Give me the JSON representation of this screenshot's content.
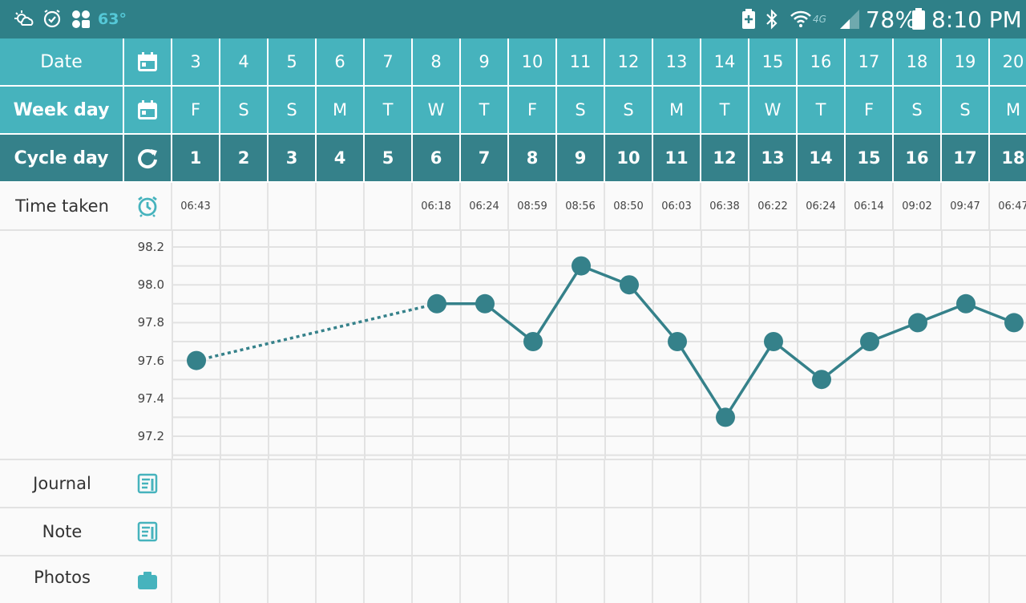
{
  "status_bar": {
    "temperature": "63°",
    "network": "4G",
    "battery": "78%",
    "time": "8:10 PM",
    "left_icons": [
      "weather-icon",
      "alarm-icon",
      "app-grid-icon"
    ],
    "right_icons": [
      "battery-saver-icon",
      "bluetooth-icon",
      "wifi-icon",
      "signal-icon",
      "battery-icon"
    ]
  },
  "rows": {
    "date": {
      "label": "Date",
      "icon": "calendar-icon"
    },
    "weekday": {
      "label": "Week day",
      "icon": "calendar-icon"
    },
    "cycle": {
      "label": "Cycle day",
      "icon": "refresh-icon"
    },
    "time": {
      "label": "Time taken",
      "icon": "alarm-clock-icon"
    },
    "journal": {
      "label": "Journal",
      "icon": "journal-icon"
    },
    "note": {
      "label": "Note",
      "icon": "note-icon"
    },
    "photos": {
      "label": "Photos",
      "icon": "camera-icon"
    }
  },
  "days": [
    {
      "date": "3",
      "weekday": "F",
      "cycle": "1",
      "time": "06:43",
      "temp": 97.6
    },
    {
      "date": "4",
      "weekday": "S",
      "cycle": "2",
      "time": "",
      "temp": null
    },
    {
      "date": "5",
      "weekday": "S",
      "cycle": "3",
      "time": "",
      "temp": null
    },
    {
      "date": "6",
      "weekday": "M",
      "cycle": "4",
      "time": "",
      "temp": null
    },
    {
      "date": "7",
      "weekday": "T",
      "cycle": "5",
      "time": "",
      "temp": null
    },
    {
      "date": "8",
      "weekday": "W",
      "cycle": "6",
      "time": "06:18",
      "temp": 97.9
    },
    {
      "date": "9",
      "weekday": "T",
      "cycle": "7",
      "time": "06:24",
      "temp": 97.9
    },
    {
      "date": "10",
      "weekday": "F",
      "cycle": "8",
      "time": "08:59",
      "temp": 97.7
    },
    {
      "date": "11",
      "weekday": "S",
      "cycle": "9",
      "time": "08:56",
      "temp": 98.1
    },
    {
      "date": "12",
      "weekday": "S",
      "cycle": "10",
      "time": "08:50",
      "temp": 98.0
    },
    {
      "date": "13",
      "weekday": "M",
      "cycle": "11",
      "time": "06:03",
      "temp": 97.7
    },
    {
      "date": "14",
      "weekday": "T",
      "cycle": "12",
      "time": "06:38",
      "temp": 97.3
    },
    {
      "date": "15",
      "weekday": "W",
      "cycle": "13",
      "time": "06:22",
      "temp": 97.7
    },
    {
      "date": "16",
      "weekday": "T",
      "cycle": "14",
      "time": "06:24",
      "temp": 97.5
    },
    {
      "date": "17",
      "weekday": "F",
      "cycle": "15",
      "time": "06:14",
      "temp": 97.7
    },
    {
      "date": "18",
      "weekday": "S",
      "cycle": "16",
      "time": "09:02",
      "temp": 97.8
    },
    {
      "date": "19",
      "weekday": "S",
      "cycle": "17",
      "time": "09:47",
      "temp": 97.9
    },
    {
      "date": "20",
      "weekday": "M",
      "cycle": "18",
      "time": "06:47",
      "temp": 97.8
    }
  ],
  "chart_data": {
    "type": "line",
    "x": [
      "1",
      "2",
      "3",
      "4",
      "5",
      "6",
      "7",
      "8",
      "9",
      "10",
      "11",
      "12",
      "13",
      "14",
      "15",
      "16",
      "17",
      "18"
    ],
    "series": [
      {
        "values": [
          97.6,
          null,
          null,
          null,
          null,
          97.9,
          97.9,
          97.7,
          98.1,
          98.0,
          97.7,
          97.3,
          97.7,
          97.5,
          97.7,
          97.8,
          97.9,
          97.8
        ]
      }
    ],
    "y_ticks": [
      "98.2",
      "98.0",
      "97.8",
      "97.6",
      "97.4",
      "97.2"
    ],
    "ylim": [
      97.1,
      98.2
    ],
    "gap_style": "dotted",
    "line_color": "#35818a"
  },
  "colors": {
    "statusbar": "#2f8088",
    "header": "#46b3bd",
    "cycle_header": "#35818a",
    "line": "#35818a",
    "icon_teal": "#46b3bd"
  }
}
